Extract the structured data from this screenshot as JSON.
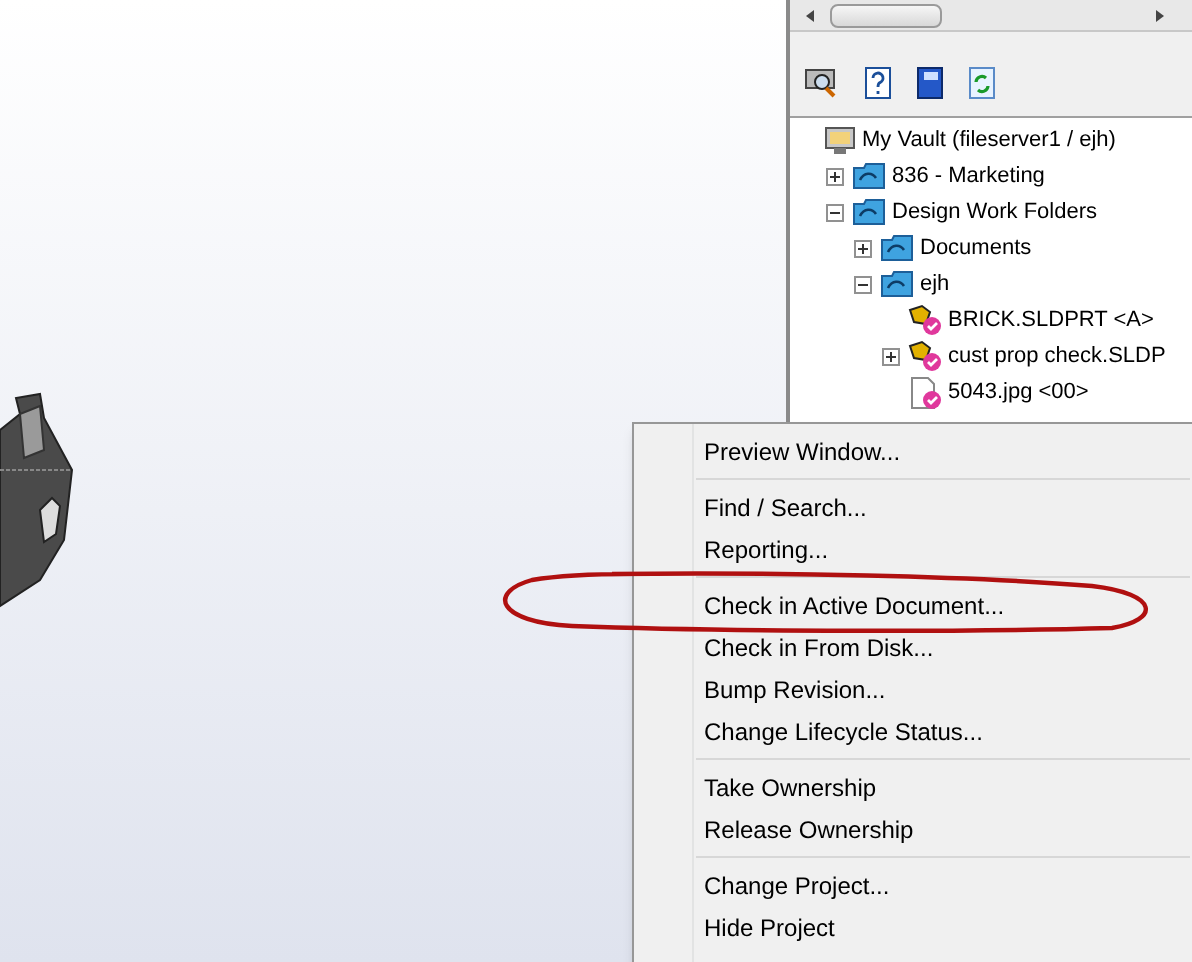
{
  "tree": [
    {
      "kind": "vault",
      "label": "My Vault (fileserver1 / ejh)",
      "children": [
        {
          "kind": "folder",
          "label": "836 - Marketing",
          "expanded": false
        },
        {
          "kind": "folder",
          "label": "Design Work Folders",
          "expanded": true,
          "children": [
            {
              "kind": "folder",
              "label": "Documents",
              "expanded": false
            },
            {
              "kind": "folder",
              "label": "ejh",
              "expanded": true,
              "children": [
                {
                  "kind": "part",
                  "label": "BRICK.SLDPRT <A>"
                },
                {
                  "kind": "part",
                  "label": "cust prop check.SLDP",
                  "expanded": false
                },
                {
                  "kind": "image",
                  "label": "5043.jpg <00>"
                }
              ]
            }
          ]
        }
      ]
    }
  ],
  "context_menu": [
    {
      "kind": "item",
      "label": "Preview Window..."
    },
    {
      "kind": "separator"
    },
    {
      "kind": "item",
      "label": "Find / Search..."
    },
    {
      "kind": "item",
      "label": "Reporting..."
    },
    {
      "kind": "separator"
    },
    {
      "kind": "item",
      "label": "Check in Active Document...",
      "circled": true
    },
    {
      "kind": "item",
      "label": "Check in From Disk..."
    },
    {
      "kind": "item",
      "label": "Bump Revision..."
    },
    {
      "kind": "item",
      "label": "Change Lifecycle Status..."
    },
    {
      "kind": "separator"
    },
    {
      "kind": "item",
      "label": "Take Ownership"
    },
    {
      "kind": "item",
      "label": "Release Ownership"
    },
    {
      "kind": "separator"
    },
    {
      "kind": "item",
      "label": "Change Project..."
    },
    {
      "kind": "item",
      "label": "Hide Project"
    }
  ]
}
